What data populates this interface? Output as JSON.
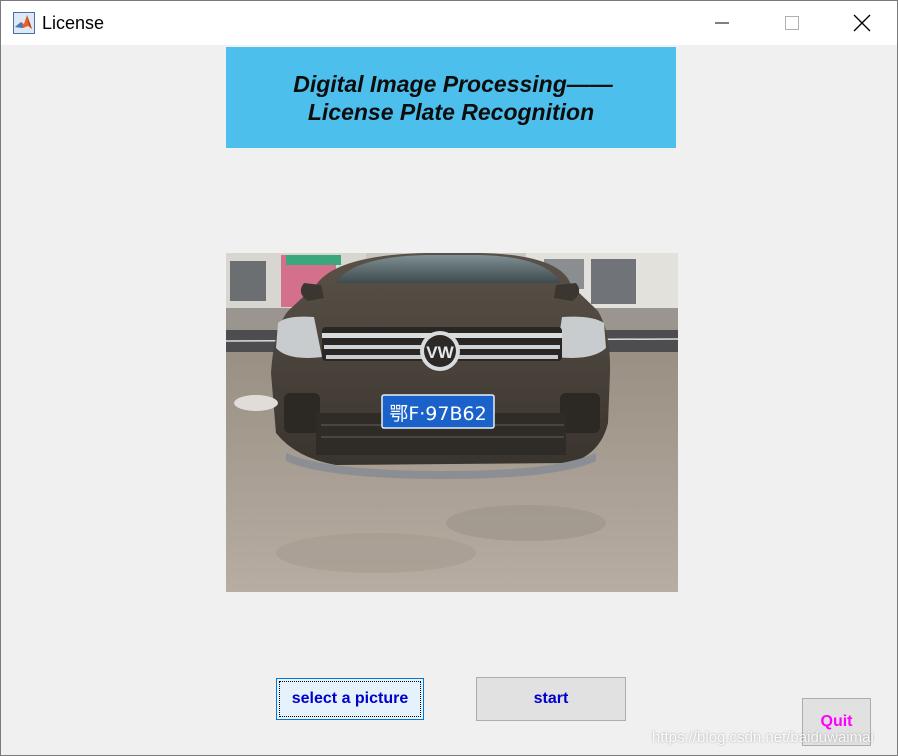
{
  "window": {
    "title": "License",
    "icon": "matlab-icon"
  },
  "banner": {
    "line1": "Digital Image Processing——",
    "line2": "License Plate Recognition",
    "background": "#4dbfed"
  },
  "image": {
    "plate_text": "鄂F·97B62",
    "brand_logo": "VW"
  },
  "buttons": {
    "select_label": "select a picture",
    "start_label": "start",
    "quit_label": "Quit"
  },
  "watermark": "https://blog.csdn.net/baiduwaimai",
  "colors": {
    "button_text": "#0000cc",
    "quit_text": "#ff00ff",
    "plate_blue": "#1a62c9"
  }
}
